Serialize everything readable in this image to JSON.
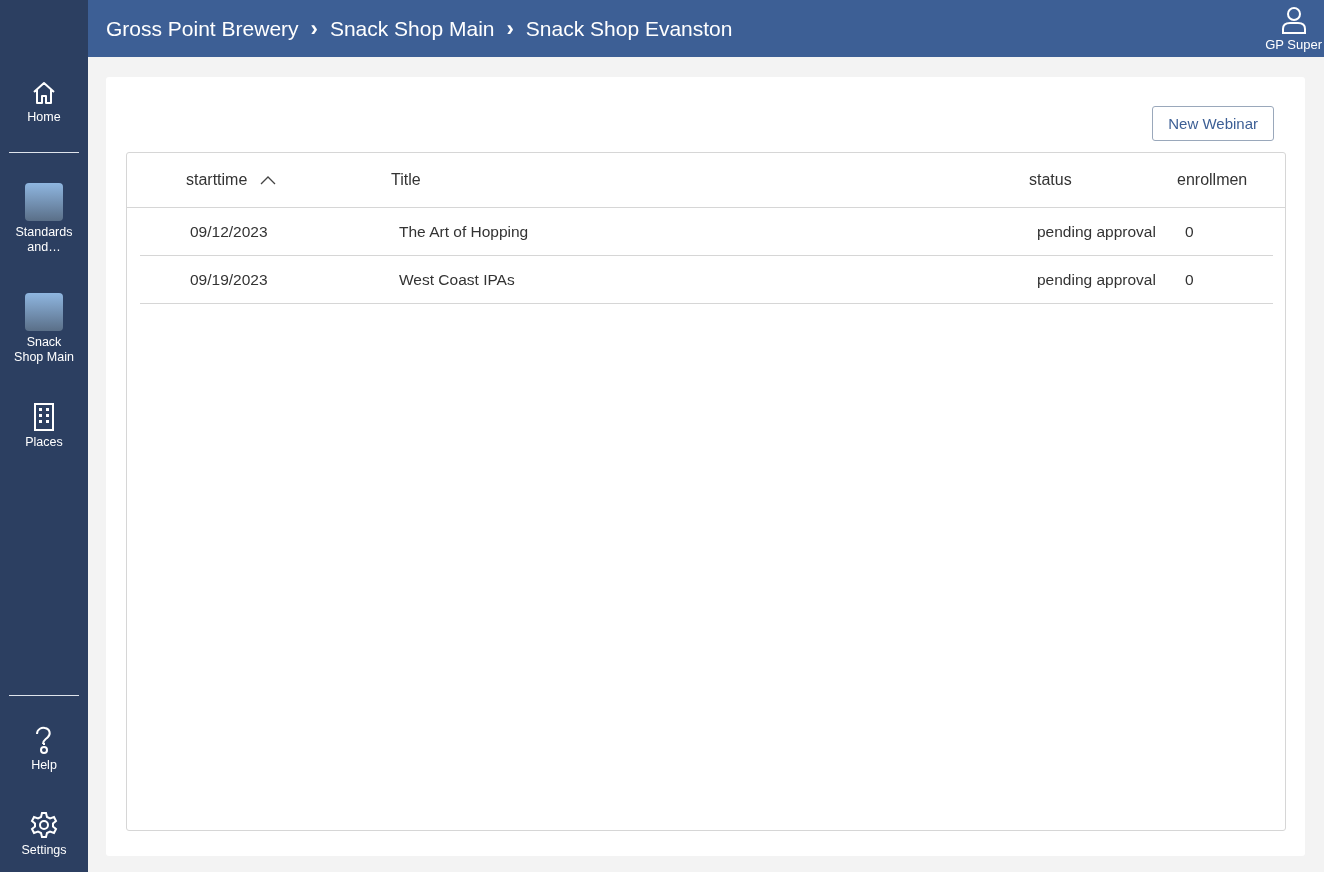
{
  "sidebar": {
    "top_items": [
      {
        "kind": "home",
        "label": "Home"
      }
    ],
    "items": [
      {
        "kind": "photo",
        "label": "Standards and…"
      },
      {
        "kind": "photo",
        "label": "Snack Shop Main"
      },
      {
        "kind": "places",
        "label": "Places"
      }
    ],
    "bottom_items": [
      {
        "kind": "help",
        "label": "Help"
      },
      {
        "kind": "settings",
        "label": "Settings"
      }
    ]
  },
  "header": {
    "breadcrumbs": [
      "Gross Point Brewery",
      "Snack Shop Main",
      "Snack Shop Evanston"
    ],
    "separator": "›",
    "user": "GP Super"
  },
  "toolbar": {
    "button": "New Webinar"
  },
  "table": {
    "columns": [
      {
        "label": "starttime",
        "sorted_ascending": true
      },
      {
        "label": "Title",
        "sorted_ascending": false
      },
      {
        "label": "status",
        "sorted_ascending": false
      },
      {
        "label": "enrollmen",
        "sorted_ascending": false
      }
    ],
    "rows": [
      [
        "09/12/2023",
        "The Art of Hopping",
        "pending approval",
        "0"
      ],
      [
        "09/19/2023",
        "West Coast IPAs",
        "pending approval",
        "0"
      ]
    ]
  }
}
